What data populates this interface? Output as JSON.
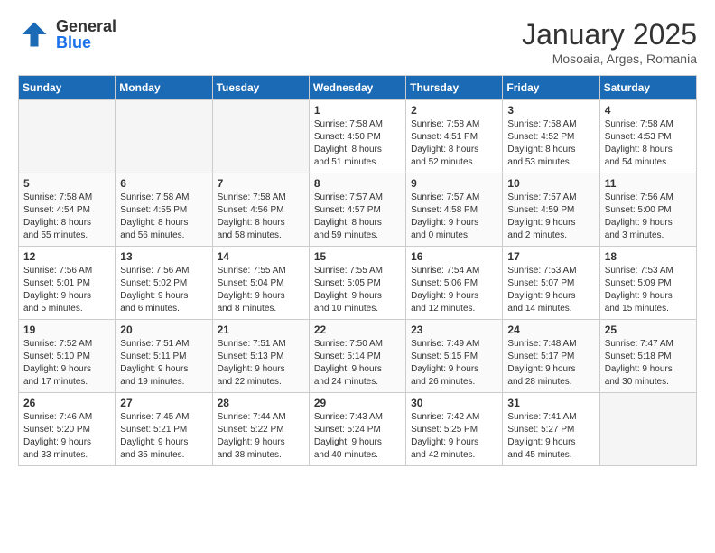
{
  "header": {
    "logo": {
      "general": "General",
      "blue": "Blue"
    },
    "title": "January 2025",
    "location": "Mosoaia, Arges, Romania"
  },
  "weekdays": [
    "Sunday",
    "Monday",
    "Tuesday",
    "Wednesday",
    "Thursday",
    "Friday",
    "Saturday"
  ],
  "weeks": [
    [
      {
        "day": null,
        "info": null
      },
      {
        "day": null,
        "info": null
      },
      {
        "day": null,
        "info": null
      },
      {
        "day": "1",
        "info": "Sunrise: 7:58 AM\nSunset: 4:50 PM\nDaylight: 8 hours\nand 51 minutes."
      },
      {
        "day": "2",
        "info": "Sunrise: 7:58 AM\nSunset: 4:51 PM\nDaylight: 8 hours\nand 52 minutes."
      },
      {
        "day": "3",
        "info": "Sunrise: 7:58 AM\nSunset: 4:52 PM\nDaylight: 8 hours\nand 53 minutes."
      },
      {
        "day": "4",
        "info": "Sunrise: 7:58 AM\nSunset: 4:53 PM\nDaylight: 8 hours\nand 54 minutes."
      }
    ],
    [
      {
        "day": "5",
        "info": "Sunrise: 7:58 AM\nSunset: 4:54 PM\nDaylight: 8 hours\nand 55 minutes."
      },
      {
        "day": "6",
        "info": "Sunrise: 7:58 AM\nSunset: 4:55 PM\nDaylight: 8 hours\nand 56 minutes."
      },
      {
        "day": "7",
        "info": "Sunrise: 7:58 AM\nSunset: 4:56 PM\nDaylight: 8 hours\nand 58 minutes."
      },
      {
        "day": "8",
        "info": "Sunrise: 7:57 AM\nSunset: 4:57 PM\nDaylight: 8 hours\nand 59 minutes."
      },
      {
        "day": "9",
        "info": "Sunrise: 7:57 AM\nSunset: 4:58 PM\nDaylight: 9 hours\nand 0 minutes."
      },
      {
        "day": "10",
        "info": "Sunrise: 7:57 AM\nSunset: 4:59 PM\nDaylight: 9 hours\nand 2 minutes."
      },
      {
        "day": "11",
        "info": "Sunrise: 7:56 AM\nSunset: 5:00 PM\nDaylight: 9 hours\nand 3 minutes."
      }
    ],
    [
      {
        "day": "12",
        "info": "Sunrise: 7:56 AM\nSunset: 5:01 PM\nDaylight: 9 hours\nand 5 minutes."
      },
      {
        "day": "13",
        "info": "Sunrise: 7:56 AM\nSunset: 5:02 PM\nDaylight: 9 hours\nand 6 minutes."
      },
      {
        "day": "14",
        "info": "Sunrise: 7:55 AM\nSunset: 5:04 PM\nDaylight: 9 hours\nand 8 minutes."
      },
      {
        "day": "15",
        "info": "Sunrise: 7:55 AM\nSunset: 5:05 PM\nDaylight: 9 hours\nand 10 minutes."
      },
      {
        "day": "16",
        "info": "Sunrise: 7:54 AM\nSunset: 5:06 PM\nDaylight: 9 hours\nand 12 minutes."
      },
      {
        "day": "17",
        "info": "Sunrise: 7:53 AM\nSunset: 5:07 PM\nDaylight: 9 hours\nand 14 minutes."
      },
      {
        "day": "18",
        "info": "Sunrise: 7:53 AM\nSunset: 5:09 PM\nDaylight: 9 hours\nand 15 minutes."
      }
    ],
    [
      {
        "day": "19",
        "info": "Sunrise: 7:52 AM\nSunset: 5:10 PM\nDaylight: 9 hours\nand 17 minutes."
      },
      {
        "day": "20",
        "info": "Sunrise: 7:51 AM\nSunset: 5:11 PM\nDaylight: 9 hours\nand 19 minutes."
      },
      {
        "day": "21",
        "info": "Sunrise: 7:51 AM\nSunset: 5:13 PM\nDaylight: 9 hours\nand 22 minutes."
      },
      {
        "day": "22",
        "info": "Sunrise: 7:50 AM\nSunset: 5:14 PM\nDaylight: 9 hours\nand 24 minutes."
      },
      {
        "day": "23",
        "info": "Sunrise: 7:49 AM\nSunset: 5:15 PM\nDaylight: 9 hours\nand 26 minutes."
      },
      {
        "day": "24",
        "info": "Sunrise: 7:48 AM\nSunset: 5:17 PM\nDaylight: 9 hours\nand 28 minutes."
      },
      {
        "day": "25",
        "info": "Sunrise: 7:47 AM\nSunset: 5:18 PM\nDaylight: 9 hours\nand 30 minutes."
      }
    ],
    [
      {
        "day": "26",
        "info": "Sunrise: 7:46 AM\nSunset: 5:20 PM\nDaylight: 9 hours\nand 33 minutes."
      },
      {
        "day": "27",
        "info": "Sunrise: 7:45 AM\nSunset: 5:21 PM\nDaylight: 9 hours\nand 35 minutes."
      },
      {
        "day": "28",
        "info": "Sunrise: 7:44 AM\nSunset: 5:22 PM\nDaylight: 9 hours\nand 38 minutes."
      },
      {
        "day": "29",
        "info": "Sunrise: 7:43 AM\nSunset: 5:24 PM\nDaylight: 9 hours\nand 40 minutes."
      },
      {
        "day": "30",
        "info": "Sunrise: 7:42 AM\nSunset: 5:25 PM\nDaylight: 9 hours\nand 42 minutes."
      },
      {
        "day": "31",
        "info": "Sunrise: 7:41 AM\nSunset: 5:27 PM\nDaylight: 9 hours\nand 45 minutes."
      },
      {
        "day": null,
        "info": null
      }
    ]
  ]
}
